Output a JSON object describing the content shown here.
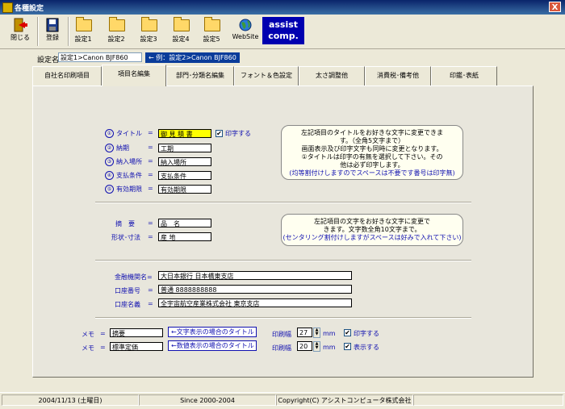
{
  "window": {
    "title": "各種設定",
    "close_label": "X"
  },
  "toolbar": {
    "close": "閉じる",
    "save": "登録",
    "set1": "設定1",
    "set2": "設定2",
    "set3": "設定3",
    "set4": "設定4",
    "set5": "設定5",
    "website": "WebSite",
    "assist_line1": "assist",
    "assist_line2": "comp."
  },
  "setting": {
    "label": "設定名",
    "value": "設定1>Canon BJF860",
    "example": "← 例：設定2>Canon BJF860"
  },
  "tabs": [
    {
      "label": "自社名印刷項目"
    },
    {
      "label": "項目名編集"
    },
    {
      "label": "部門･分類名編集"
    },
    {
      "label": "フォント＆色設定"
    },
    {
      "label": "太さ調整他"
    },
    {
      "label": "消費税･備考他"
    },
    {
      "label": "印鑑･表紙"
    }
  ],
  "section1": {
    "items": [
      {
        "num": "①",
        "label": "タイトル",
        "eq": "=",
        "value": "御 見 積 書"
      },
      {
        "num": "②",
        "label": "納期",
        "eq": "=",
        "value": "工期"
      },
      {
        "num": "③",
        "label": "納入場所",
        "eq": "=",
        "value": "納入場所"
      },
      {
        "num": "④",
        "label": "支払条件",
        "eq": "=",
        "value": "支払条件"
      },
      {
        "num": "⑤",
        "label": "有効期限",
        "eq": "=",
        "value": "有効期限"
      }
    ],
    "print_label": "印字する",
    "note": [
      "左記項目のタイトルをお好きな文字に変更できま",
      "す。（全角5文字まで）",
      "画面表示及び印字文字も同時に変更となります。",
      "①タイトルは印字の有無を選択して下さい。その",
      "他は必ず印字します。",
      "(均等割付けしますのでスペースは不要です番号は印字無)"
    ]
  },
  "section2": {
    "items": [
      {
        "label": "摘　要",
        "eq": "=",
        "value": "品　名"
      },
      {
        "label": "形状･寸法",
        "eq": "=",
        "value": "産 地"
      }
    ],
    "note": [
      "左記項目の文字をお好きな文字に変更で",
      "きます。文字数全角10文字まで。",
      "(センタリング割付けしますがスペースは好みで入れて下さい)"
    ]
  },
  "section3": {
    "items": [
      {
        "label": "金融機関名",
        "eq": "=",
        "value": "大日本銀行 日本橋東支店"
      },
      {
        "label": "口座番号",
        "eq": "=",
        "value": "普通 8888888888"
      },
      {
        "label": "口座名義",
        "eq": "=",
        "value": "全宇宙航空産業株式会社 東京支店"
      }
    ]
  },
  "section4": {
    "rows": [
      {
        "label": "メモ",
        "eq": "=",
        "value": "摘要",
        "btn": "←文字表示の場合のタイトル",
        "width_label": "印刷幅",
        "width": "27",
        "unit": "mm",
        "check_label": "印字する"
      },
      {
        "label": "メモ",
        "eq": "=",
        "value": "標準定価",
        "btn": "←数値表示の場合のタイトル",
        "width_label": "印刷幅",
        "width": "20",
        "unit": "mm",
        "check_label": "表示する"
      }
    ]
  },
  "statusbar": {
    "date": "2004/11/13 (土曜日)",
    "since": "Since 2000-2004",
    "copyright": "Copyright(C) アシストコンピュータ株式会社"
  },
  "colors": {
    "title_bar": "#0a246a",
    "highlight_field": "#ffff00",
    "label_blue": "#1010b0"
  }
}
